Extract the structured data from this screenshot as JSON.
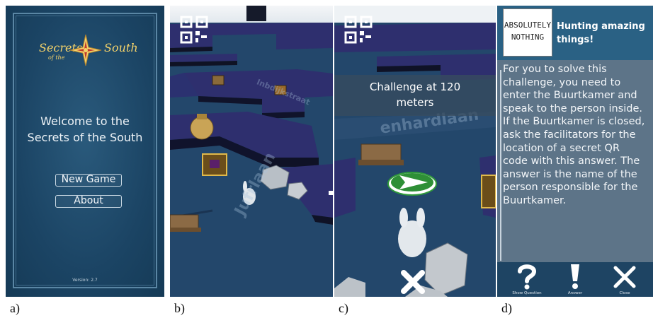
{
  "panel_a": {
    "logo": {
      "word1": "Secrets",
      "word2": "of the",
      "word3": "South"
    },
    "welcome_line1": "Welcome to the",
    "welcome_line2": "Secrets of the South",
    "new_game_label": "New Game",
    "about_label": "About",
    "version": "Version: 2.7"
  },
  "panel_b": {
    "street_label_1": "Inbdijkstraat",
    "street_label_2": "Jufrlaan"
  },
  "panel_c": {
    "challenge_line1": "Challenge at 120",
    "challenge_line2": "meters",
    "street_label": "enhardlaan"
  },
  "panel_d": {
    "logo_line1": "ABSOLUTELY",
    "logo_line2": "NOTHING",
    "title": "Hunting amazing things!",
    "body": "For you to solve this challenge, you need to enter the Buurtkamer and speak to the person inside. If the Buurtkamer is closed, ask the facilitators for the location of a secret QR code with this answer. The answer is the name of the person responsible for the Buurtkamer.",
    "show_question_label": "Show Question",
    "answer_label": "Answer",
    "close_label": "Close"
  },
  "captions": {
    "a": "a)",
    "b": "b)",
    "c": "c)",
    "d": "d)"
  },
  "colors": {
    "menu_bg": "#1d4868",
    "logo_gold": "#f5d36a",
    "map_water": "#22466a",
    "building_purple": "#2e2f6e",
    "dialog_text_bg": "#5d7488"
  }
}
